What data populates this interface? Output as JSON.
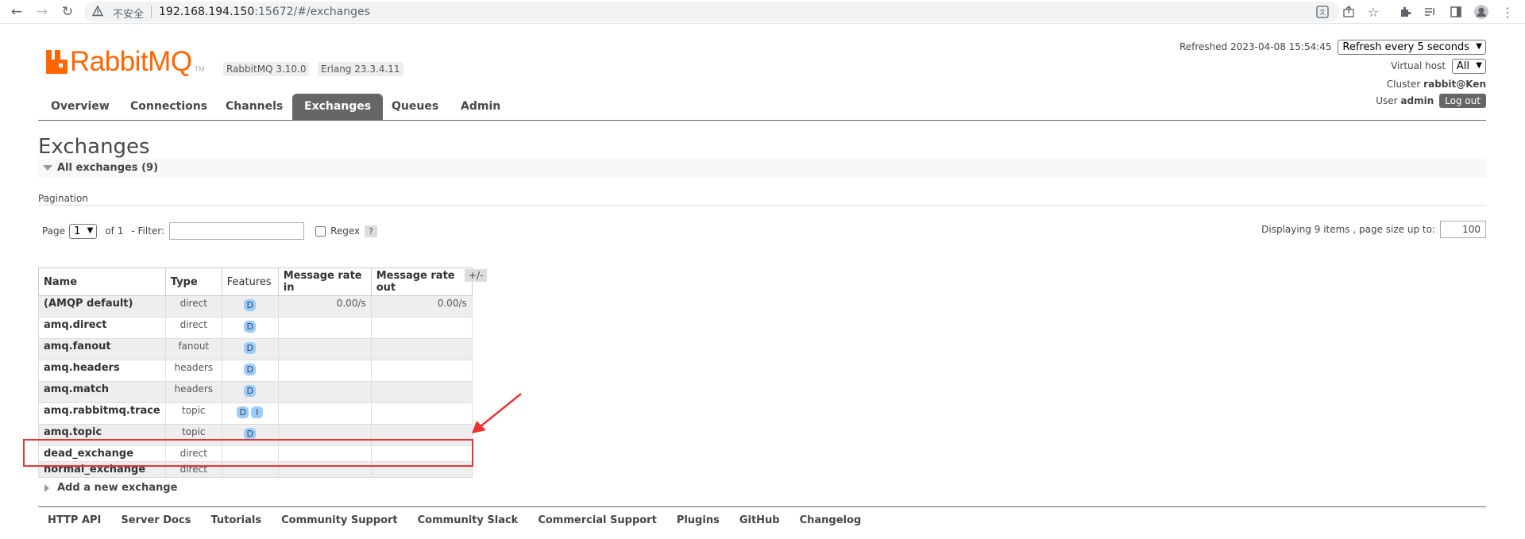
{
  "browser": {
    "insecure_label": "不安全",
    "url_host": "192.168.194.150",
    "url_rest": ":15672/#/exchanges"
  },
  "header": {
    "logo_text": "RabbitMQ",
    "logo_tm": "TM",
    "rabbitmq_version": "RabbitMQ 3.10.0",
    "erlang_version": "Erlang 23.3.4.11",
    "refreshed": "Refreshed 2023-04-08 15:54:45",
    "refresh_option": "Refresh every 5 seconds",
    "virtual_host_label": "Virtual host",
    "virtual_host_value": "All",
    "cluster_label": "Cluster",
    "cluster_value": "rabbit@Ken",
    "user_label": "User",
    "user_value": "admin",
    "logout_label": "Log out"
  },
  "tabs": [
    {
      "label": "Overview"
    },
    {
      "label": "Connections"
    },
    {
      "label": "Channels"
    },
    {
      "label": "Exchanges",
      "active": true
    },
    {
      "label": "Queues"
    },
    {
      "label": "Admin"
    }
  ],
  "page": {
    "title": "Exchanges",
    "section_label": "All exchanges (9)",
    "pagination_label": "Pagination",
    "page_label": "Page",
    "page_value": "1",
    "of_label": "of 1",
    "filter_label": "- Filter:",
    "regex_label": "Regex",
    "help_label": "?",
    "displaying_label": "Displaying 9 items , page size up to:",
    "page_size": "100",
    "plusminus_label": "+/-",
    "add_new_label": "Add a new exchange"
  },
  "table": {
    "columns": [
      "Name",
      "Type",
      "Features",
      "Message rate in",
      "Message rate out"
    ],
    "rows": [
      {
        "name": "(AMQP default)",
        "type": "direct",
        "features": [
          "D"
        ],
        "rate_in": "0.00/s",
        "rate_out": "0.00/s"
      },
      {
        "name": "amq.direct",
        "type": "direct",
        "features": [
          "D"
        ],
        "rate_in": "",
        "rate_out": ""
      },
      {
        "name": "amq.fanout",
        "type": "fanout",
        "features": [
          "D"
        ],
        "rate_in": "",
        "rate_out": ""
      },
      {
        "name": "amq.headers",
        "type": "headers",
        "features": [
          "D"
        ],
        "rate_in": "",
        "rate_out": ""
      },
      {
        "name": "amq.match",
        "type": "headers",
        "features": [
          "D"
        ],
        "rate_in": "",
        "rate_out": ""
      },
      {
        "name": "amq.rabbitmq.trace",
        "type": "topic",
        "features": [
          "D",
          "I"
        ],
        "rate_in": "",
        "rate_out": ""
      },
      {
        "name": "amq.topic",
        "type": "topic",
        "features": [
          "D"
        ],
        "rate_in": "",
        "rate_out": ""
      },
      {
        "name": "dead_exchange",
        "type": "direct",
        "features": [],
        "rate_in": "",
        "rate_out": ""
      },
      {
        "name": "normal_exchange",
        "type": "direct",
        "features": [],
        "rate_in": "",
        "rate_out": ""
      }
    ]
  },
  "footer": {
    "links": [
      "HTTP API",
      "Server Docs",
      "Tutorials",
      "Community Support",
      "Community Slack",
      "Commercial Support",
      "Plugins",
      "GitHub",
      "Changelog"
    ]
  },
  "colors": {
    "brand_orange": "#ff6600",
    "tab_active": "#666666",
    "feature_badge": "#99ccff",
    "annotation_red": "#ee3333"
  }
}
